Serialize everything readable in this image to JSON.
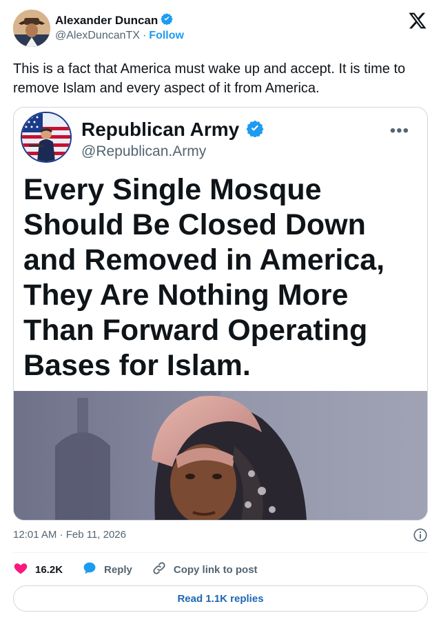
{
  "author": {
    "display_name": "Alexander Duncan",
    "handle": "@AlexDuncanTX",
    "separator": "·",
    "follow_label": "Follow",
    "verified_icon": "verified-badge-icon"
  },
  "tweet": {
    "text": "This is a fact that America must wake up and accept. It is time to remove Islam and every aspect of it from America.",
    "timestamp": "12:01 AM · Feb 11, 2026"
  },
  "embedded_post": {
    "display_name": "Republican Army",
    "handle": "@Republican.Army",
    "more_glyph": "•••",
    "headline": "Every Single Mosque Should Be Closed Down and Removed in America, They Are Nothing More Than Forward Operating Bases for Islam."
  },
  "actions": {
    "likes": "16.2K",
    "reply_label": "Reply",
    "copy_label": "Copy link to post"
  },
  "footer": {
    "read_replies_label": "Read 1.1K replies"
  },
  "colors": {
    "accent": "#1d9bf0",
    "like": "#f91880",
    "text": "#0f1419",
    "muted": "#536471"
  }
}
